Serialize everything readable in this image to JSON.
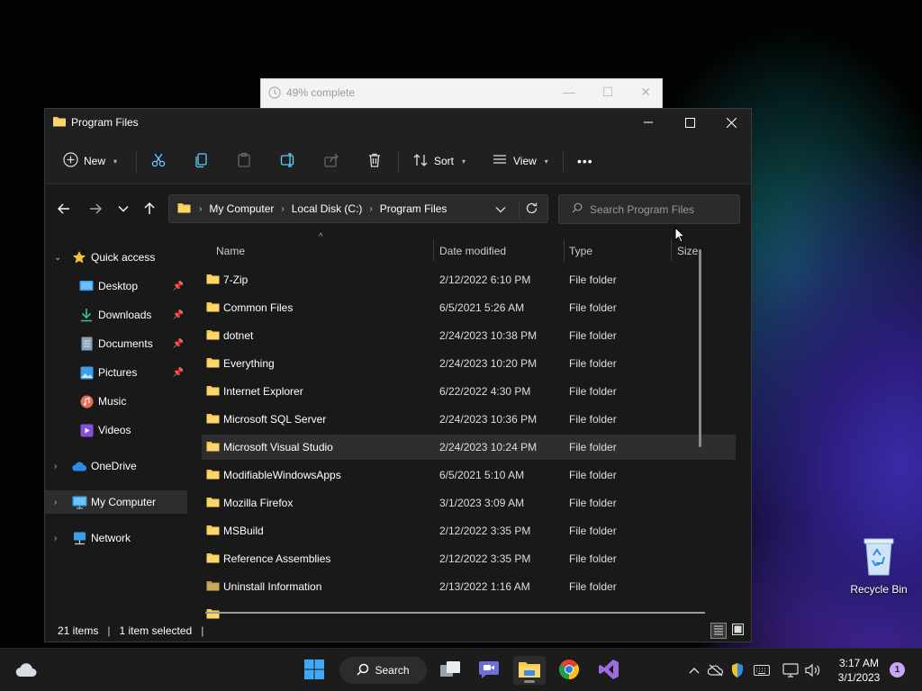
{
  "progress_dialog": {
    "title": "49% complete"
  },
  "window": {
    "title": "Program Files"
  },
  "toolbar": {
    "new_label": "New",
    "sort_label": "Sort",
    "view_label": "View",
    "more_label": "•••"
  },
  "address": {
    "crumbs": [
      "My Computer",
      "Local Disk (C:)",
      "Program Files"
    ],
    "search_placeholder": "Search Program Files"
  },
  "nav": {
    "items": [
      {
        "label": "Quick access",
        "icon": "star-icon"
      },
      {
        "label": "Desktop",
        "icon": "desktop-icon",
        "pinned": true
      },
      {
        "label": "Downloads",
        "icon": "download-icon",
        "pinned": true
      },
      {
        "label": "Documents",
        "icon": "documents-icon",
        "pinned": true
      },
      {
        "label": "Pictures",
        "icon": "pictures-icon",
        "pinned": true
      },
      {
        "label": "Music",
        "icon": "music-icon"
      },
      {
        "label": "Videos",
        "icon": "videos-icon"
      },
      {
        "label": "OneDrive",
        "icon": "cloud-icon"
      },
      {
        "label": "My Computer",
        "icon": "computer-icon"
      },
      {
        "label": "Network",
        "icon": "network-icon"
      }
    ]
  },
  "columns": {
    "name": "Name",
    "date": "Date modified",
    "type": "Type",
    "size": "Size"
  },
  "files": [
    {
      "name": "7-Zip",
      "date": "2/12/2022 6:10 PM",
      "type": "File folder"
    },
    {
      "name": "Common Files",
      "date": "6/5/2021 5:26 AM",
      "type": "File folder"
    },
    {
      "name": "dotnet",
      "date": "2/24/2023 10:38 PM",
      "type": "File folder"
    },
    {
      "name": "Everything",
      "date": "2/24/2023 10:20 PM",
      "type": "File folder"
    },
    {
      "name": "Internet Explorer",
      "date": "6/22/2022 4:30 PM",
      "type": "File folder"
    },
    {
      "name": "Microsoft SQL Server",
      "date": "2/24/2023 10:36 PM",
      "type": "File folder"
    },
    {
      "name": "Microsoft Visual Studio",
      "date": "2/24/2023 10:24 PM",
      "type": "File folder"
    },
    {
      "name": "ModifiableWindowsApps",
      "date": "6/5/2021 5:10 AM",
      "type": "File folder"
    },
    {
      "name": "Mozilla Firefox",
      "date": "3/1/2023 3:09 AM",
      "type": "File folder"
    },
    {
      "name": "MSBuild",
      "date": "2/12/2022 3:35 PM",
      "type": "File folder"
    },
    {
      "name": "Reference Assemblies",
      "date": "2/12/2022 3:35 PM",
      "type": "File folder"
    },
    {
      "name": "Uninstall Information",
      "date": "2/13/2022 1:16 AM",
      "type": "File folder"
    }
  ],
  "status": {
    "item_count": "21 items",
    "selection": "1 item selected"
  },
  "desktop": {
    "recycle_bin_label": "Recycle Bin"
  },
  "taskbar": {
    "search_label": "Search",
    "time": "3:17 AM",
    "date": "3/1/2023",
    "notification_count": "1"
  },
  "colors": {
    "accent": "#4cc2ff",
    "folder": "#f8c84a",
    "window_bg": "#191919",
    "chrome_bg": "#202020"
  }
}
